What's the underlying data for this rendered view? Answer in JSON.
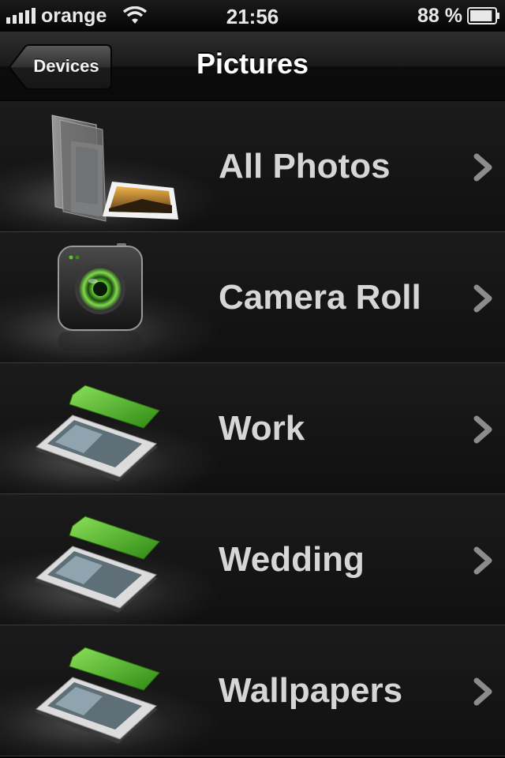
{
  "status_bar": {
    "carrier": "orange",
    "time": "21:56",
    "battery": "88 %",
    "battery_level": 0.88
  },
  "nav": {
    "back_label": "Devices",
    "title": "Pictures"
  },
  "rows": [
    {
      "label": "All Photos",
      "icon": "folder-photos-icon"
    },
    {
      "label": "Camera Roll",
      "icon": "camera-icon"
    },
    {
      "label": "Work",
      "icon": "album-icon"
    },
    {
      "label": "Wedding",
      "icon": "album-icon"
    },
    {
      "label": "Wallpapers",
      "icon": "album-icon"
    }
  ],
  "colors": {
    "accent_green": "#5cc62f",
    "background": "#111111",
    "label": "#d6d6d6"
  }
}
